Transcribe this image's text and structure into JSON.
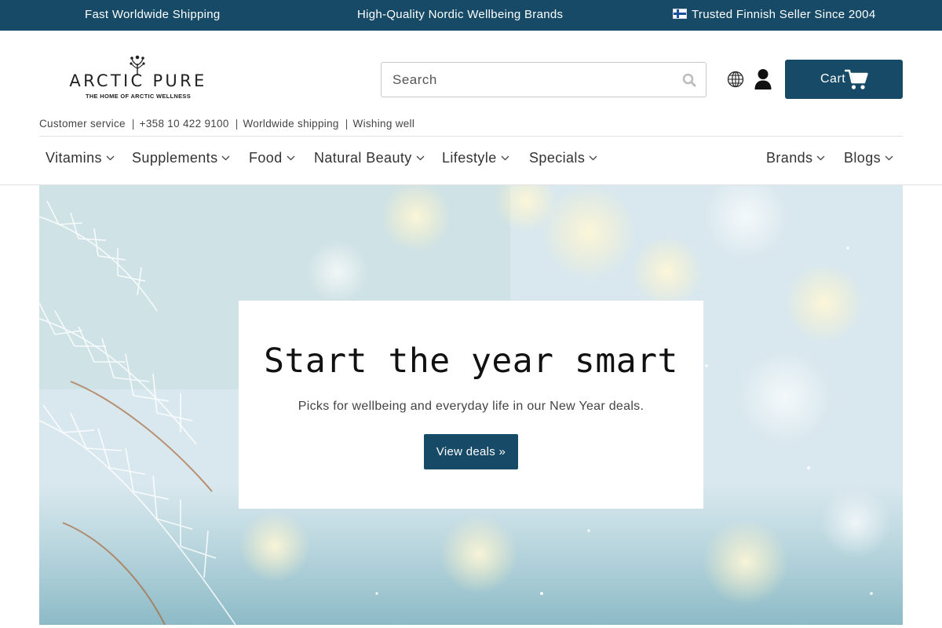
{
  "announcement": {
    "left": "Fast Worldwide Shipping",
    "center": "High-Quality Nordic Wellbeing Brands",
    "right": "Trusted Finnish Seller Since 2004"
  },
  "header": {
    "logo_name": "ARCTIC PURE",
    "logo_tagline": "THE HOME OF ARCTIC WELLNESS",
    "search_placeholder": "Search",
    "cart_label": "Cart"
  },
  "infobar": {
    "items": [
      "Customer service",
      "+358 10 422 9100",
      "Worldwide shipping",
      "Wishing well"
    ]
  },
  "nav": {
    "left": [
      "Vitamins",
      "Supplements",
      "Food",
      "Natural Beauty",
      "Lifestyle",
      "Specials"
    ],
    "right": [
      "Brands",
      "Blogs"
    ]
  },
  "hero": {
    "title": "Start the year smart",
    "subtitle": "Picks for wellbeing and everyday life in our New Year deals.",
    "button_label": "View deals »"
  },
  "colors": {
    "brand": "#164a66",
    "text": "#333333"
  },
  "icons": [
    "finland-flag-icon",
    "search-icon",
    "globe-icon",
    "account-icon",
    "cart-icon",
    "chevron-down-icon"
  ]
}
